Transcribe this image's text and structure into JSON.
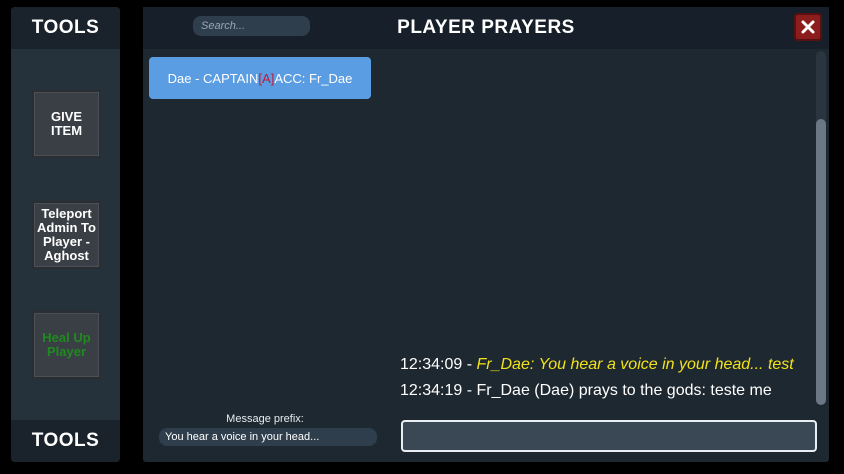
{
  "tools": {
    "header": "TOOLS",
    "footer": "TOOLS",
    "buttons": [
      {
        "label": "GIVE ITEM"
      },
      {
        "label": "Teleport Admin To Player - Aghost"
      },
      {
        "label": "Heal Up Player",
        "color": "#1f8a1f"
      }
    ]
  },
  "window": {
    "title": "PLAYER PRAYERS",
    "search_placeholder": "Search...",
    "close_icon": "close-x-icon",
    "accent_close": "#8c1d1d"
  },
  "players": [
    {
      "name": "Dae - CAPTAIN",
      "tag": "[A]",
      "account": " ACC: Fr_Dae",
      "selected": true
    }
  ],
  "chat": [
    {
      "time": "12:34:09",
      "sep": " - ",
      "text": "Fr_Dae: You hear a voice in your head... test",
      "style": "yellow"
    },
    {
      "time": "12:34:19",
      "sep": " - ",
      "text": "Fr_Dae (Dae) prays to the gods: teste me",
      "style": "normal"
    }
  ],
  "prefix": {
    "label": "Message prefix:",
    "value": "You hear a voice in your head..."
  },
  "message": {
    "value": ""
  }
}
